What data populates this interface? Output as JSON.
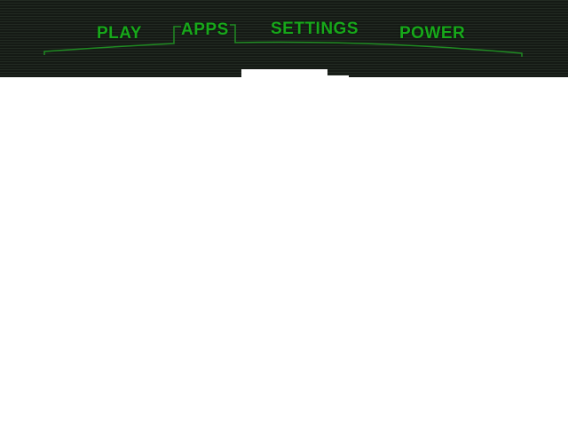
{
  "menu": {
    "tabs": [
      {
        "label": "PLAY",
        "selected": false
      },
      {
        "label": "APPS",
        "selected": true
      },
      {
        "label": "SETTINGS",
        "selected": false
      },
      {
        "label": "POWER",
        "selected": false
      }
    ]
  },
  "colors": {
    "accent": "#17a81a",
    "frame_line": "#1f8a22",
    "bar_background": "#1b211b",
    "content_background": "#ffffff"
  }
}
